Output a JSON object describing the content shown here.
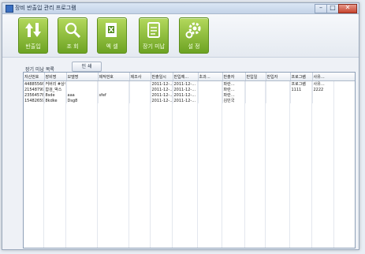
{
  "window": {
    "title": "장비 반출입 관리 프로그램",
    "controls": {
      "minimize": "–",
      "maximize": "□",
      "close": "✕"
    }
  },
  "toolbar": {
    "buttons": [
      {
        "label": "반출입",
        "icon": "up-down-arrows-icon"
      },
      {
        "label": "조 회",
        "icon": "search-magnifier-icon"
      },
      {
        "label": "엑 셀",
        "icon": "excel-sheet-icon"
      },
      {
        "label": "장기 미납",
        "icon": "notepad-icon"
      },
      {
        "label": "설 정",
        "icon": "gear-icon"
      }
    ],
    "accent": "#8cc63f"
  },
  "tabs": {
    "list_label": "장기 미납 목록",
    "action_label": "인 쇄"
  },
  "table": {
    "columns": [
      "자산번호",
      "장비명",
      "모델명",
      "제작번호",
      "제조사",
      "반출일시",
      "반입예…",
      "초과…",
      "반출자",
      "반입일",
      "반입자",
      "프로그램",
      "사유…"
    ],
    "rows": [
      [
        "44885566",
        "커버리 #상각대",
        "",
        "",
        "",
        "2011-12-…",
        "2011-12-…",
        "",
        "파란…",
        "",
        "",
        "프로그램",
        "사유…"
      ],
      [
        "21548799",
        "합검_박스",
        "",
        "",
        "",
        "2011-12-…",
        "2011-12-…",
        "",
        "파란…",
        "",
        "",
        "1111",
        "2222"
      ],
      [
        "23564578",
        "8sde",
        "aaa",
        "sfef",
        "",
        "2011-12-…",
        "2011-12-…",
        "",
        "파란…",
        "",
        "",
        "",
        ""
      ],
      [
        "15482659",
        "8kdke",
        "Dsg8",
        "",
        "",
        "2011-12-…",
        "2011-12-…",
        "",
        "김민국",
        "",
        "",
        "",
        ""
      ]
    ]
  }
}
